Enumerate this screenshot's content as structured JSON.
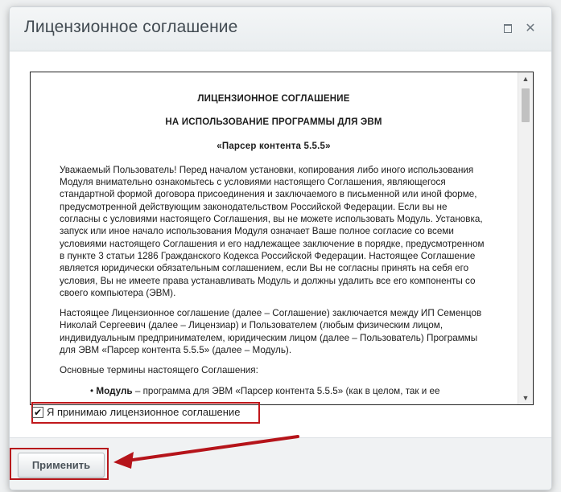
{
  "dialog": {
    "title": "Лицензионное соглашение",
    "maximize_icon": "maximize-icon",
    "close_icon": "close-icon",
    "close_glyph": "✕"
  },
  "license": {
    "heading1": "ЛИЦЕНЗИОННОЕ СОГЛАШЕНИЕ",
    "heading2": "НА ИСПОЛЬЗОВАНИЕ ПРОГРАММЫ ДЛЯ ЭВМ",
    "heading3": "«Парсер контента 5.5.5»",
    "para1": "Уважаемый Пользователь! Перед началом установки, копирования либо иного использования Модуля внимательно ознакомьтесь с условиями настоящего Соглашения, являющегося стандартной формой договора присоединения и заключаемого в письменной или иной форме, предусмотренной действующим законодательством Российской Федерации. Если вы не согласны с условиями настоящего Соглашения, вы не можете использовать Модуль. Установка, запуск или иное начало использования Модуля означает Ваше полное согласие со всеми условиями настоящего Соглашения и его надлежащее заключение в порядке, предусмотренном в пункте 3 статьи 1286 Гражданского Кодекса Российской Федерации. Настоящее Соглашение является юридически обязательным соглашением, если Вы не согласны принять на себя его условия, Вы не имеете права устанавливать Модуль и должны удалить все его компоненты со своего компьютера (ЭВМ).",
    "para2": "Настоящее Лицензионное соглашение (далее – Соглашение) заключается между ИП Семенцов Николай Сергеевич (далее – Лицензиар) и Пользователем (любым физическим лицом, индивидуальным предпринимателем, юридическим лицом (далее – Пользователь) Программы для ЭВМ «Парсер контента 5.5.5» (далее – Модуль).",
    "para3": "Основные термины настоящего Соглашения:",
    "bullet_glyph": "•",
    "bullet1_term": "Модуль",
    "bullet1_text": " – программа для ЭВМ «Парсер контента 5.5.5» (как в целом, так и ее"
  },
  "accept": {
    "checked": true,
    "check_glyph": "✔",
    "label": "Я принимаю лицензионное соглашение"
  },
  "footer": {
    "apply_label": "Применить"
  },
  "colors": {
    "highlight": "#c0171b",
    "arrow": "#b5141a",
    "title_text": "#424b52"
  }
}
